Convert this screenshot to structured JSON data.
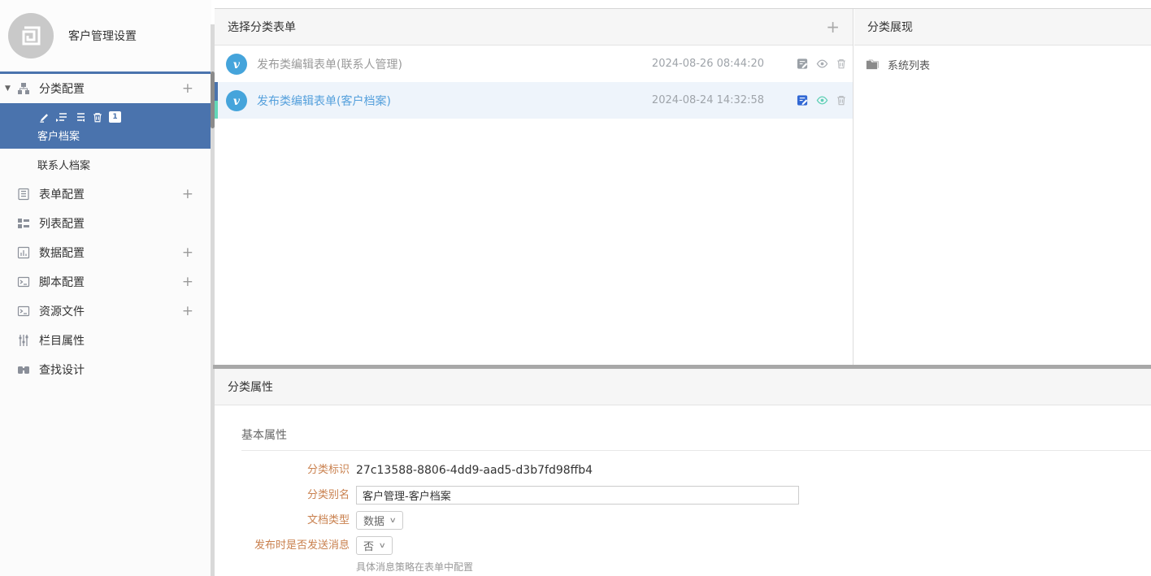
{
  "ui": {
    "plus": "+",
    "caret": "∨",
    "triangle_down": "▼",
    "sort_badge": "1"
  },
  "header": {
    "title": "客户管理设置"
  },
  "sidebar": {
    "items": [
      {
        "label": "分类配置",
        "expanded": true,
        "has_add": true
      },
      {
        "label": "表单配置",
        "has_add": true
      },
      {
        "label": "列表配置",
        "has_add": false
      },
      {
        "label": "数据配置",
        "has_add": true
      },
      {
        "label": "脚本配置",
        "has_add": true
      },
      {
        "label": "资源文件",
        "has_add": true
      },
      {
        "label": "栏目属性",
        "has_add": false
      },
      {
        "label": "查找设计",
        "has_add": false
      }
    ],
    "children": [
      {
        "label": "客户档案",
        "selected": true
      },
      {
        "label": "联系人档案",
        "selected": false
      }
    ]
  },
  "form_list": {
    "title": "选择分类表单",
    "rows": [
      {
        "title": "发布类编辑表单(联系人管理)",
        "timestamp": "2024-08-26 08:44:20",
        "selected": false
      },
      {
        "title": "发布类编辑表单(客户档案)",
        "timestamp": "2024-08-24 14:32:58",
        "selected": true
      }
    ]
  },
  "display_panel": {
    "title": "分类展现",
    "items": [
      {
        "label": "系统列表"
      }
    ]
  },
  "properties": {
    "title": "分类属性",
    "section": "基本属性",
    "fields": {
      "id": {
        "label": "分类标识",
        "value": "27c13588-8806-4dd9-aad5-d3b7fd98ffb4"
      },
      "alias": {
        "label": "分类别名",
        "value": "客户管理-客户档案"
      },
      "doc_type": {
        "label": "文档类型",
        "value": "数据"
      },
      "send_message": {
        "label": "发布时是否发送消息",
        "value": "否",
        "helper": "具体消息策略在表单中配置"
      }
    }
  },
  "colors": {
    "accent_blue": "#4a73ad",
    "accent_teal": "#62d8b8",
    "selected_row_bg": "#eef4fb",
    "selected_row_text": "#55a0dc",
    "row_icon_blue": "#45a4db",
    "label_orange": "#c9804e",
    "active_edit_icon": "#3168d4",
    "active_eye_icon": "#5fd0b5",
    "splitter_gray": "#a8a8a8"
  }
}
